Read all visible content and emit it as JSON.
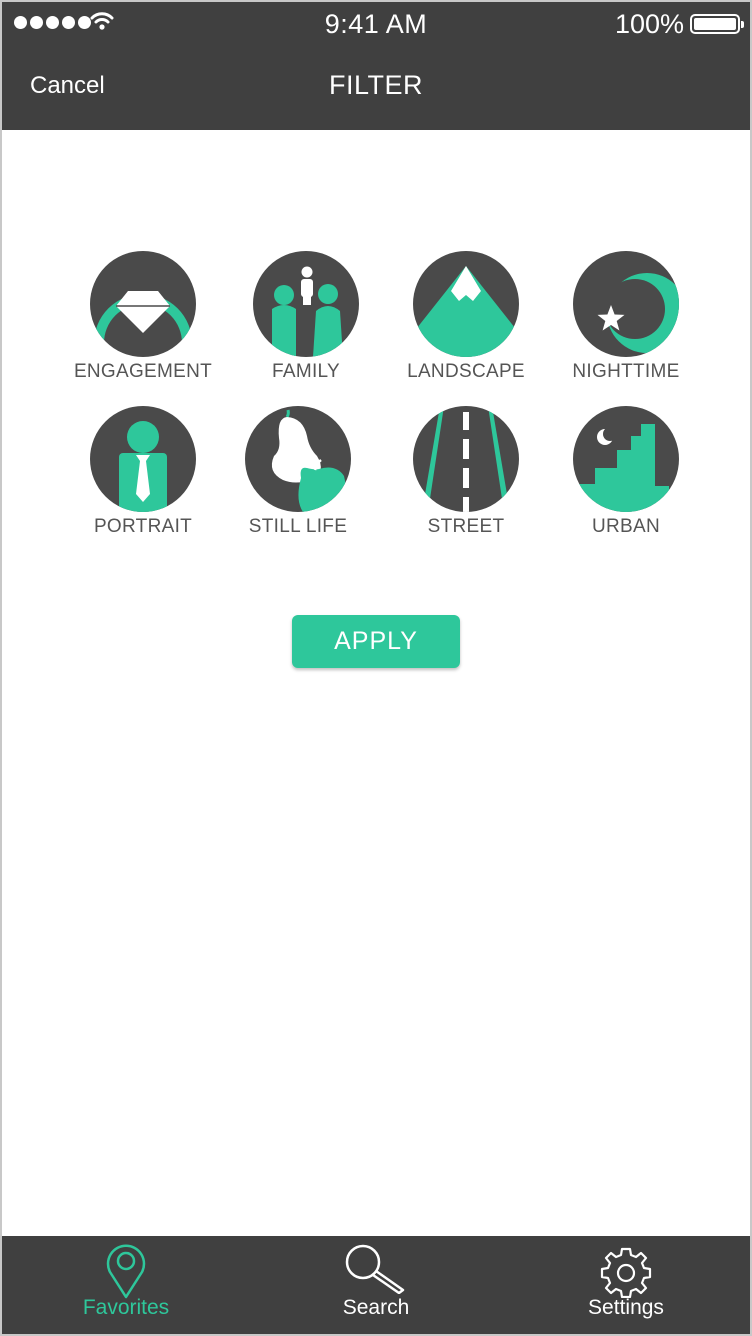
{
  "status_bar": {
    "time": "9:41 AM",
    "battery": "100%"
  },
  "header": {
    "cancel_label": "Cancel",
    "title": "FILTER"
  },
  "categories": [
    {
      "label": "ENGAGEMENT",
      "icon": "ring-icon"
    },
    {
      "label": "FAMILY",
      "icon": "family-icon"
    },
    {
      "label": "LANDSCAPE",
      "icon": "mountain-icon"
    },
    {
      "label": "NIGHTTIME",
      "icon": "moon-star-icon"
    },
    {
      "label": "PORTRAIT",
      "icon": "person-icon"
    },
    {
      "label": "STILL LIFE",
      "icon": "pear-apple-icon"
    },
    {
      "label": "STREET",
      "icon": "road-icon"
    },
    {
      "label": "URBAN",
      "icon": "city-icon"
    }
  ],
  "apply_label": "APPLY",
  "tabbar": {
    "items": [
      {
        "label": "Favorites",
        "icon": "map-pin-icon",
        "active": true
      },
      {
        "label": "Search",
        "icon": "magnifier-icon",
        "active": false
      },
      {
        "label": "Settings",
        "icon": "gear-icon",
        "active": false
      }
    ]
  },
  "colors": {
    "accent": "#2ec79b",
    "dark": "#404040",
    "icon_circle": "#4a4a4a",
    "label_text": "#555555"
  }
}
